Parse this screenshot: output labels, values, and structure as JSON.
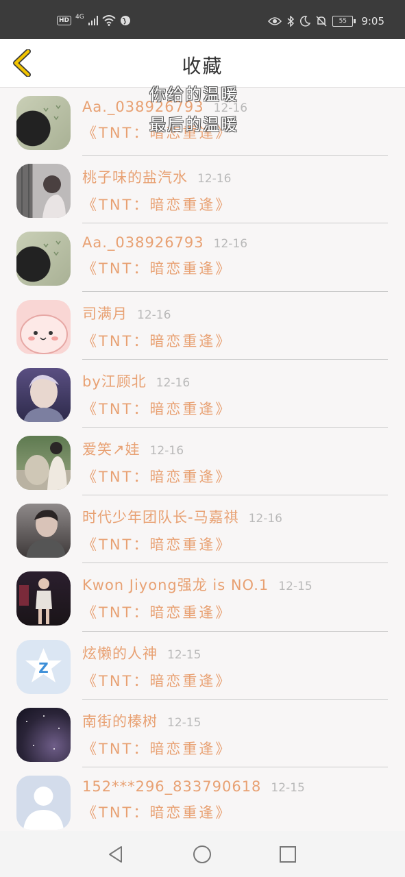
{
  "status_bar": {
    "hd": "HD",
    "network": "4G",
    "battery": "55",
    "time": "9:05"
  },
  "header": {
    "title": "收藏",
    "back_icon": "back-chevron-icon"
  },
  "overlay": {
    "line1": "你给的温暖",
    "line2": "最后的温暖"
  },
  "colors": {
    "accent": "#e8a173",
    "date": "#b9b9b9",
    "back": "#f2c400"
  },
  "items": [
    {
      "name": "Aa._038926793",
      "date": "12-16",
      "book": "《TNT：暗恋重逢》"
    },
    {
      "name": "桃子味的盐汽水",
      "date": "12-16",
      "book": "《TNT：暗恋重逢》"
    },
    {
      "name": "Aa._038926793",
      "date": "12-16",
      "book": "《TNT：暗恋重逢》"
    },
    {
      "name": "司满月",
      "date": "12-16",
      "book": "《TNT：暗恋重逢》"
    },
    {
      "name": "by江顾北",
      "date": "12-16",
      "book": "《TNT：暗恋重逢》"
    },
    {
      "name": "爱笑↗娃",
      "date": "12-16",
      "book": "《TNT：暗恋重逢》"
    },
    {
      "name": "时代少年团队长-马嘉祺",
      "date": "12-16",
      "book": "《TNT：暗恋重逢》"
    },
    {
      "name": "Kwon Jiyong强龙 is NO.1",
      "date": "12-15",
      "book": "《TNT：暗恋重逢》"
    },
    {
      "name": "炫懒的人神",
      "date": "12-15",
      "book": "《TNT：暗恋重逢》"
    },
    {
      "name": "南街的榛树",
      "date": "12-15",
      "book": "《TNT：暗恋重逢》"
    },
    {
      "name": "152***296_833790618",
      "date": "12-15",
      "book": "《TNT：暗恋重逢》"
    }
  ],
  "nav": {
    "back": "nav-back-icon",
    "home": "nav-home-icon",
    "recents": "nav-recents-icon"
  }
}
